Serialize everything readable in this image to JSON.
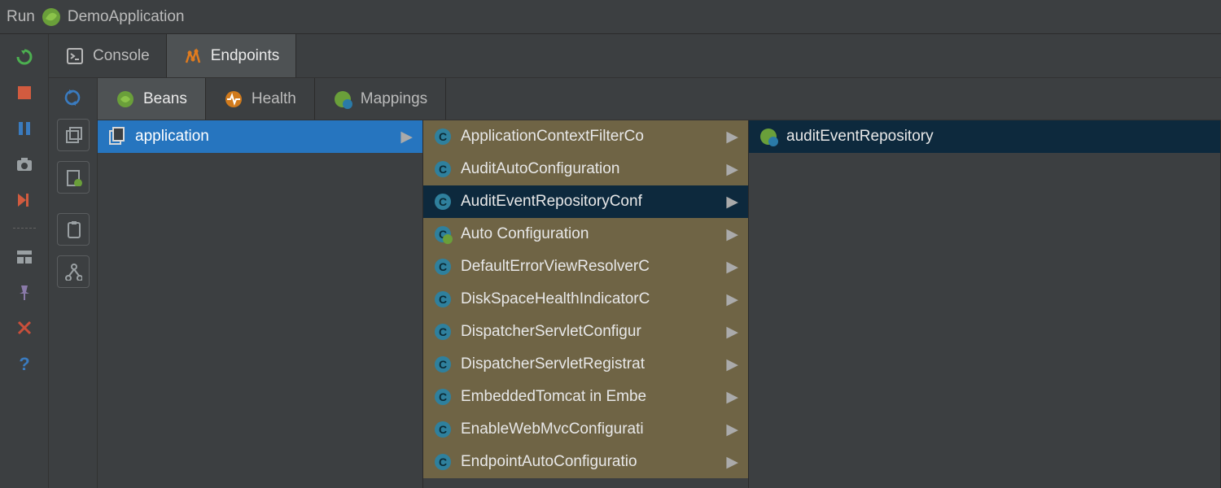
{
  "header": {
    "run_label": "Run",
    "app_name": "DemoApplication"
  },
  "top_tabs": {
    "console": "Console",
    "endpoints": "Endpoints"
  },
  "sub_tabs": {
    "beans": "Beans",
    "health": "Health",
    "mappings": "Mappings"
  },
  "cols": {
    "root": {
      "label": "application"
    },
    "beans": [
      {
        "label": "ApplicationContextFilterCo"
      },
      {
        "label": "AuditAutoConfiguration"
      },
      {
        "label": "AuditEventRepositoryConf"
      },
      {
        "label": "Auto Configuration",
        "icon": "class-leaf"
      },
      {
        "label": "DefaultErrorViewResolverC"
      },
      {
        "label": "DiskSpaceHealthIndicatorC"
      },
      {
        "label": "DispatcherServletConfigur"
      },
      {
        "label": "DispatcherServletRegistrat"
      },
      {
        "label": "EmbeddedTomcat in Embe"
      },
      {
        "label": "EnableWebMvcConfigurati"
      },
      {
        "label": "EndpointAutoConfiguratio"
      }
    ],
    "leaf": {
      "label": "auditEventRepository"
    }
  }
}
